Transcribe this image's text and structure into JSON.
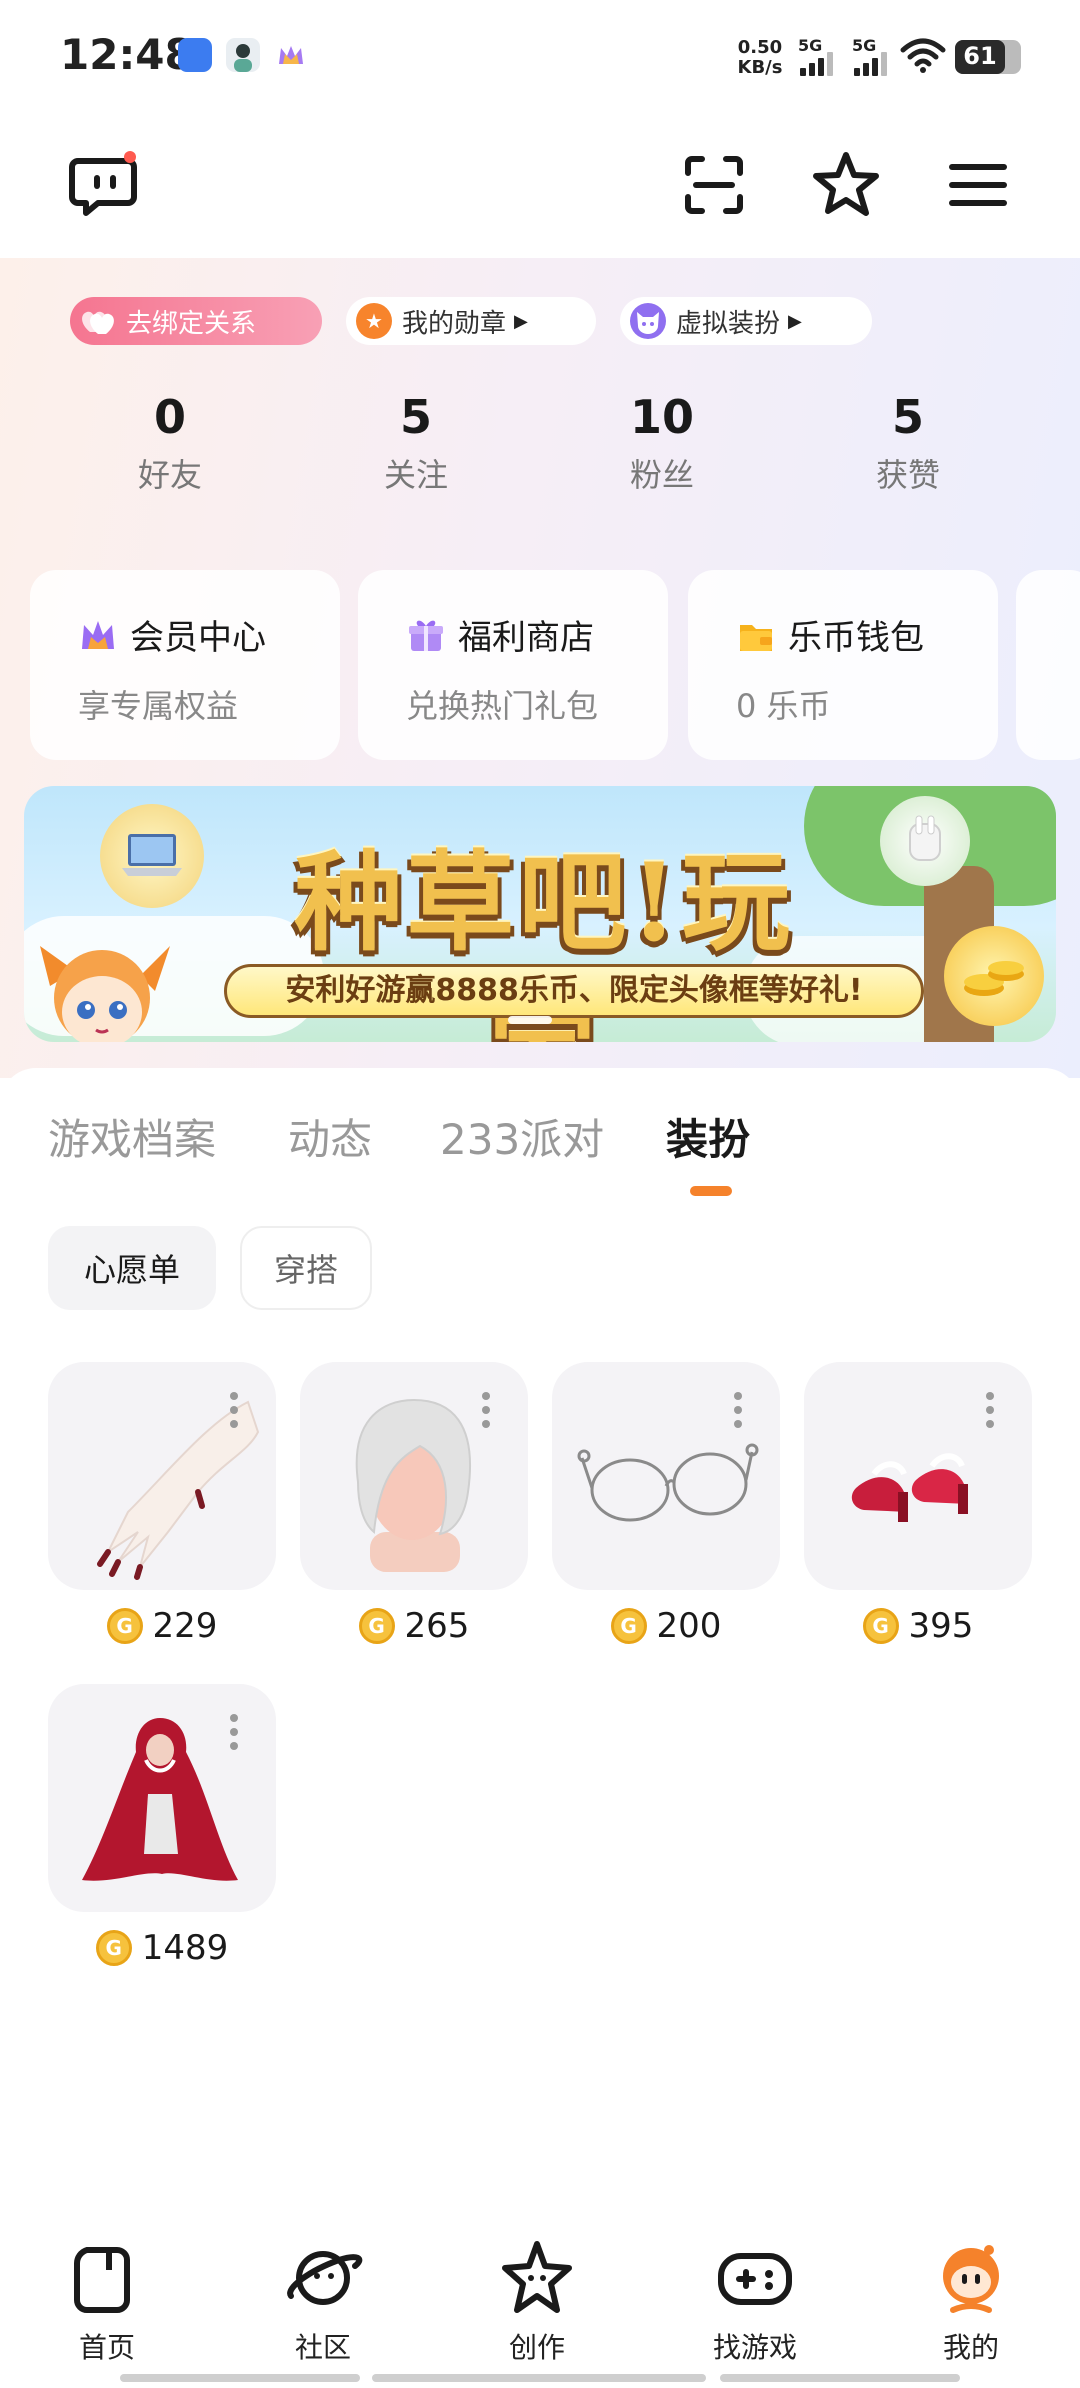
{
  "status_bar": {
    "time": "12:48",
    "net_speed_value": "0.50",
    "net_speed_unit": "KB/s",
    "signal_1": "5G",
    "signal_2": "5G",
    "battery_level": "61",
    "battery_fraction": 0.61
  },
  "header": {
    "icons": [
      "chat-icon",
      "scan-icon",
      "star-icon",
      "menu-icon"
    ],
    "chat_badge_color": "#ff5a4f"
  },
  "profile": {
    "pills": [
      {
        "label": "去绑定关系"
      },
      {
        "label": "我的勋章"
      },
      {
        "label": "虚拟装扮"
      }
    ],
    "stats": [
      {
        "value": "0",
        "label": "好友"
      },
      {
        "value": "5",
        "label": "关注"
      },
      {
        "value": "10",
        "label": "粉丝"
      },
      {
        "value": "5",
        "label": "获赞"
      }
    ]
  },
  "services": [
    {
      "title": "会员中心",
      "subtitle": "享专属权益"
    },
    {
      "title": "福利商店",
      "subtitle": "兑换热门礼包"
    },
    {
      "title": "乐币钱包",
      "subtitle": "0 乐币"
    }
  ],
  "banner": {
    "title": "种草吧!玩家",
    "subtitle": "安利好游赢8888乐币、限定头像框等好礼!"
  },
  "tabs": [
    {
      "label": "游戏档案",
      "active": false
    },
    {
      "label": "动态",
      "active": false
    },
    {
      "label": "233派对",
      "active": false
    },
    {
      "label": "装扮",
      "active": true
    }
  ],
  "chips": [
    {
      "label": "心愿单",
      "selected": true
    },
    {
      "label": "穿搭",
      "selected": false
    }
  ],
  "wishlist": [
    {
      "name": "gloves",
      "price": "229"
    },
    {
      "name": "white-hair",
      "price": "265"
    },
    {
      "name": "glasses",
      "price": "200"
    },
    {
      "name": "red-shoes",
      "price": "395"
    },
    {
      "name": "red-cloak",
      "price": "1489"
    }
  ],
  "bottom_nav": [
    {
      "label": "首页",
      "active": false
    },
    {
      "label": "社区",
      "active": false
    },
    {
      "label": "创作",
      "active": false
    },
    {
      "label": "找游戏",
      "active": false
    },
    {
      "label": "我的",
      "active": true
    }
  ],
  "colors": {
    "accent": "#f5822b",
    "coin": "#f6c23d"
  }
}
